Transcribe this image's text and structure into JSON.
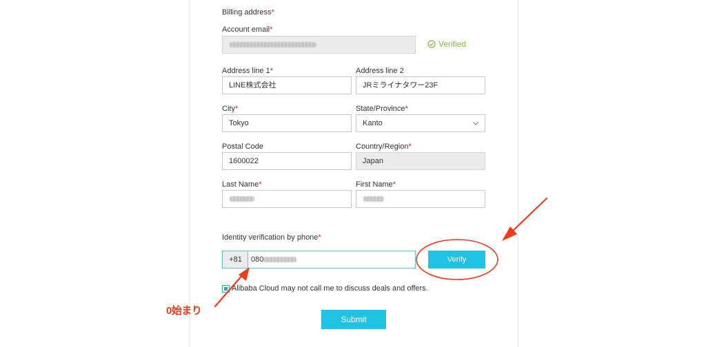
{
  "form": {
    "section_title": "Billing address",
    "required_mark": "*",
    "account_email": {
      "label": "Account email"
    },
    "verified_label": "Verified",
    "address_line1": {
      "label": "Address line 1",
      "value": "LINE株式会社"
    },
    "address_line2": {
      "label": "Address line 2",
      "value": "JRミライナタワー23F"
    },
    "city": {
      "label": "City",
      "value": "Tokyo"
    },
    "state": {
      "label": "State/Province",
      "value": "Kanto"
    },
    "postal_code": {
      "label": "Postal Code",
      "value": "1600022"
    },
    "country": {
      "label": "Country/Region",
      "value": "Japan"
    },
    "last_name": {
      "label": "Last Name"
    },
    "first_name": {
      "label": "First Name"
    },
    "phone": {
      "label": "Identity verification by phone",
      "country_code": "+81",
      "value": "080"
    },
    "verify_button": "Verify",
    "opt_out_label": "Alibaba Cloud may not call me to discuss deals and offers.",
    "submit_button": "Submit"
  },
  "annotation": {
    "text": "0始まり"
  },
  "colors": {
    "accent": "#1fc3e3",
    "required": "#e02020",
    "verified": "#7dbb3c",
    "annotation": "#f23a1a"
  }
}
